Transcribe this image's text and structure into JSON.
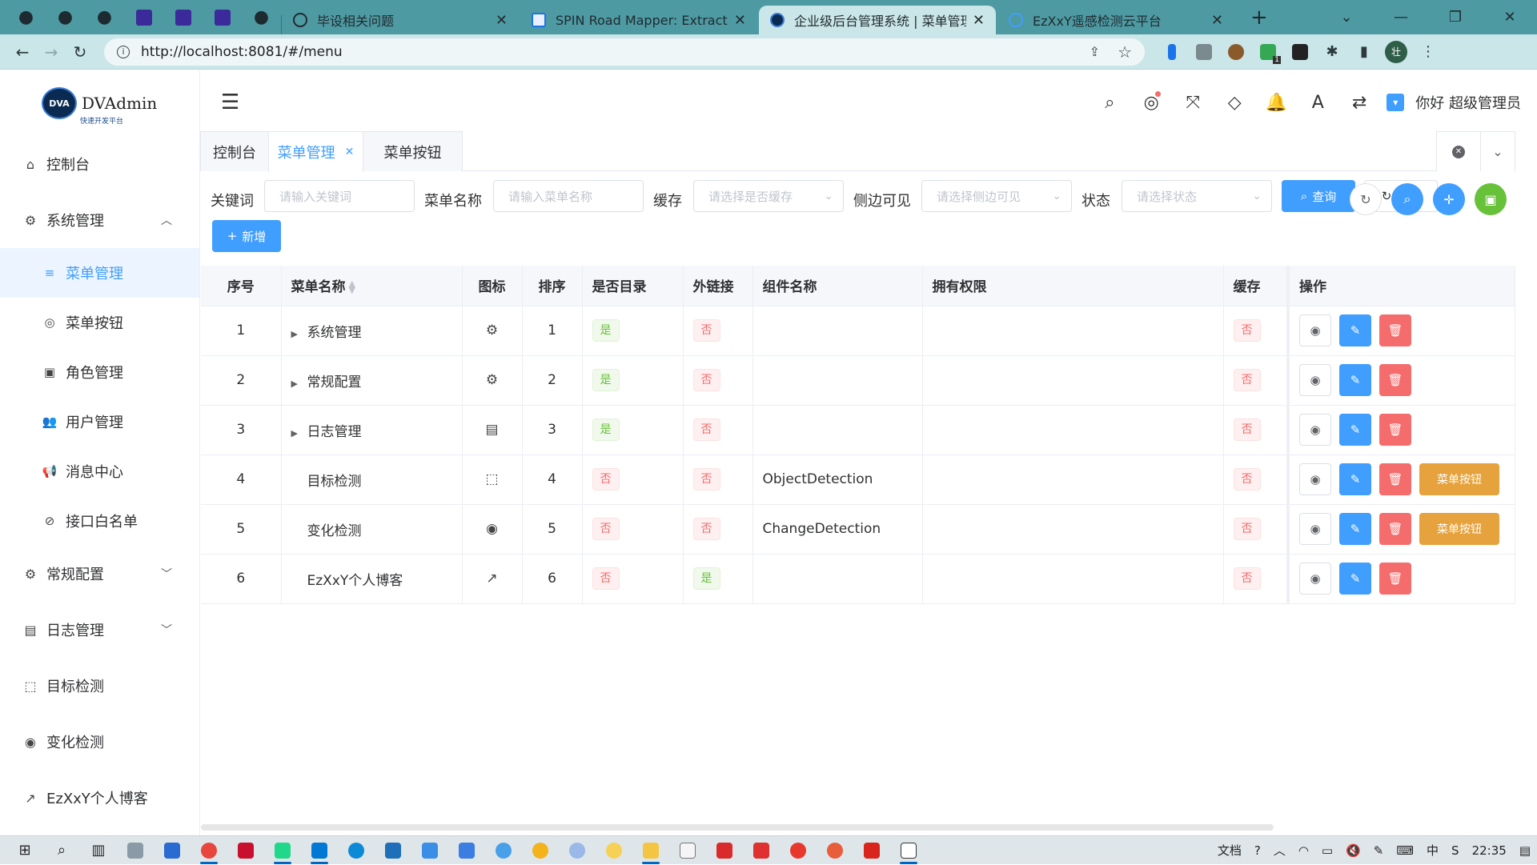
{
  "browser": {
    "tabs": [
      {
        "title": "毕设相关问题",
        "favicon_color": "#e0f2f1"
      },
      {
        "title": "SPIN Road Mapper: Extracting",
        "favicon_color": "#1a73e8"
      },
      {
        "title": "企业级后台管理系统 | 菜单管理",
        "favicon_color": "#0b2a52"
      },
      {
        "title": "EzXxY遥感检测云平台",
        "favicon_color": "#409eff"
      }
    ],
    "url": "http://localhost:8081/#/menu",
    "profile_initial": "壮",
    "ext_badge": "1"
  },
  "app": {
    "logo": {
      "badge": "DVA",
      "name": "DVAdmin",
      "subtitle": "快速开发平台"
    },
    "sidebar": {
      "items": [
        {
          "label": "控制台",
          "icon": "home-icon"
        },
        {
          "label": "系统管理",
          "icon": "gear-icon",
          "expanded": true,
          "children": [
            {
              "label": "菜单管理",
              "icon": "list-icon",
              "active": true
            },
            {
              "label": "菜单按钮",
              "icon": "target-icon"
            },
            {
              "label": "角色管理",
              "icon": "id-card-icon"
            },
            {
              "label": "用户管理",
              "icon": "users-icon"
            },
            {
              "label": "消息中心",
              "icon": "bullhorn-icon"
            },
            {
              "label": "接口白名单",
              "icon": "circle-slash-icon"
            }
          ]
        },
        {
          "label": "常规配置",
          "icon": "cogs-icon"
        },
        {
          "label": "日志管理",
          "icon": "book-icon"
        },
        {
          "label": "目标检测",
          "icon": "object-icon"
        },
        {
          "label": "变化检测",
          "icon": "radio-icon"
        },
        {
          "label": "EzXxY个人博客",
          "icon": "external-link-icon"
        }
      ]
    },
    "header": {
      "greeting": "你好 超级管理员"
    },
    "tags": [
      {
        "label": "控制台"
      },
      {
        "label": "菜单管理",
        "active": true
      },
      {
        "label": "菜单按钮"
      }
    ],
    "filter": {
      "keyword": {
        "label": "关键词",
        "placeholder": "请输入关键词"
      },
      "menu_name": {
        "label": "菜单名称",
        "placeholder": "请输入菜单名称"
      },
      "cache": {
        "label": "缓存",
        "placeholder": "请选择是否缓存"
      },
      "visible": {
        "label": "侧边可见",
        "placeholder": "请选择侧边可见"
      },
      "status": {
        "label": "状态",
        "placeholder": "请选择状态"
      },
      "query_btn": "查询",
      "reset_btn": "重置",
      "add_btn": "新增"
    },
    "table": {
      "columns": [
        "序号",
        "菜单名称",
        "图标",
        "排序",
        "是否目录",
        "外链接",
        "组件名称",
        "拥有权限",
        "缓存",
        "操作"
      ],
      "menu_button_label": "菜单按钮",
      "rows": [
        {
          "no": "1",
          "name": "系统管理",
          "expand": true,
          "icon": "gear-icon",
          "sort": "1",
          "is_dir": "是",
          "external": "否",
          "component": "",
          "perm": "",
          "cache": "否",
          "has_menu_btn": false
        },
        {
          "no": "2",
          "name": "常规配置",
          "expand": true,
          "icon": "cogs-icon",
          "sort": "2",
          "is_dir": "是",
          "external": "否",
          "component": "",
          "perm": "",
          "cache": "否",
          "has_menu_btn": false
        },
        {
          "no": "3",
          "name": "日志管理",
          "expand": true,
          "icon": "book-icon",
          "sort": "3",
          "is_dir": "是",
          "external": "否",
          "component": "",
          "perm": "",
          "cache": "否",
          "has_menu_btn": false
        },
        {
          "no": "4",
          "name": "目标检测",
          "expand": false,
          "icon": "object-icon",
          "sort": "4",
          "is_dir": "否",
          "external": "否",
          "component": "ObjectDetection",
          "perm": "",
          "cache": "否",
          "has_menu_btn": true
        },
        {
          "no": "5",
          "name": "变化检测",
          "expand": false,
          "icon": "radio-icon",
          "sort": "5",
          "is_dir": "否",
          "external": "否",
          "component": "ChangeDetection",
          "perm": "",
          "cache": "否",
          "has_menu_btn": true
        },
        {
          "no": "6",
          "name": "EzXxY个人博客",
          "expand": false,
          "icon": "external-link-icon",
          "sort": "6",
          "is_dir": "否",
          "external": "是",
          "component": "",
          "perm": "",
          "cache": "否",
          "has_menu_btn": false
        }
      ]
    }
  },
  "taskbar": {
    "ime": "文档",
    "time": "22:35"
  },
  "colors": {
    "primary": "#409eff",
    "danger": "#f56c6c",
    "warning": "#e6a23c",
    "success": "#67c23a",
    "tabbar": "#4e9aa3"
  }
}
